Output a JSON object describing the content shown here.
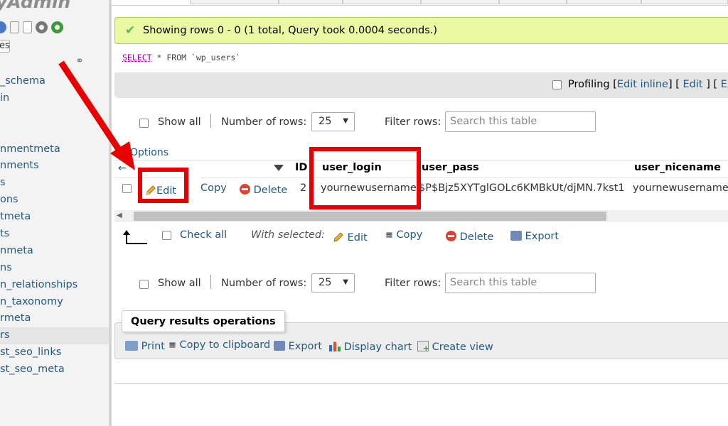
{
  "sidebar": {
    "logo_text": "yAdmin",
    "tab_label": "es",
    "items": [
      {
        "label": "_schema",
        "active": false
      },
      {
        "label": "in",
        "active": false
      },
      {
        "label": "",
        "active": false
      },
      {
        "label": "",
        "active": false
      },
      {
        "label": "nmentmeta",
        "active": false
      },
      {
        "label": "nments",
        "active": false
      },
      {
        "label": "s",
        "active": false
      },
      {
        "label": "ons",
        "active": false
      },
      {
        "label": "tmeta",
        "active": false
      },
      {
        "label": "ts",
        "active": false
      },
      {
        "label": "nmeta",
        "active": false
      },
      {
        "label": "ns",
        "active": false
      },
      {
        "label": "n_relationships",
        "active": false
      },
      {
        "label": "n_taxonomy",
        "active": false
      },
      {
        "label": "rmeta",
        "active": false
      },
      {
        "label": "rs",
        "active": true
      },
      {
        "label": "st_seo_links",
        "active": false
      },
      {
        "label": "st_seo_meta",
        "active": false
      }
    ]
  },
  "message": {
    "success_text": "Showing rows 0 - 0 (1 total, Query took 0.0004 seconds.)"
  },
  "sql": {
    "keyword": "SELECT",
    "rest": " * FROM `wp_users`"
  },
  "profiling": {
    "label": "Profiling",
    "edit_inline": "Edit inline",
    "edit": "Edit",
    "explain": "Exp"
  },
  "nav": {
    "show_all": "Show all",
    "number_of_rows": "Number of rows:",
    "rows_value": "25",
    "filter_rows": "Filter rows:",
    "search_placeholder": "Search this table"
  },
  "table": {
    "options_link": "Options",
    "columns": [
      "ID",
      "user_login",
      "user_pass",
      "user_nicename"
    ],
    "row": {
      "edit": "Edit",
      "copy": "Copy",
      "delete": "Delete",
      "id": "2",
      "user_login": "yournewusername",
      "user_pass": "$P$Bjz5XYTglGOLc6KMBkUt/djMN.7kst1",
      "user_nicename": "yournewusername"
    }
  },
  "with_selected": {
    "check_all": "Check all",
    "label": "With selected:",
    "edit": "Edit",
    "copy": "Copy",
    "delete": "Delete",
    "export": "Export"
  },
  "query_ops": {
    "legend": "Query results operations",
    "print": "Print",
    "copy_clipboard": "Copy to clipboard",
    "export": "Export",
    "display_chart": "Display chart",
    "create_view": "Create view"
  },
  "colors": {
    "link": "#235a81",
    "success_bg": "#ebf8a4",
    "annotation_red": "#e60000"
  }
}
